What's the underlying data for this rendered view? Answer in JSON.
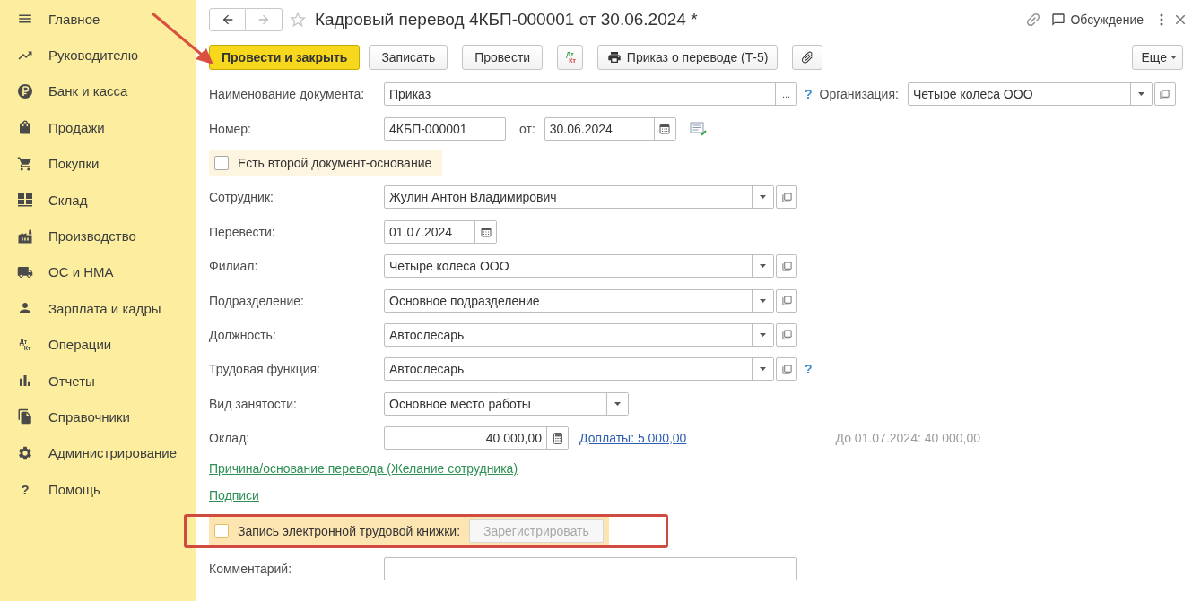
{
  "sidebar": {
    "items": [
      {
        "label": "Главное"
      },
      {
        "label": "Руководителю"
      },
      {
        "label": "Банк и касса"
      },
      {
        "label": "Продажи"
      },
      {
        "label": "Покупки"
      },
      {
        "label": "Склад"
      },
      {
        "label": "Производство"
      },
      {
        "label": "ОС и НМА"
      },
      {
        "label": "Зарплата и кадры"
      },
      {
        "label": "Операции",
        "icon_text": [
          "Дт",
          "Кт"
        ]
      },
      {
        "label": "Отчеты"
      },
      {
        "label": "Справочники"
      },
      {
        "label": "Администрирование"
      },
      {
        "label": "Помощь",
        "icon_text": [
          "?"
        ]
      }
    ]
  },
  "header": {
    "title": "Кадровый перевод 4КБП-000001 от 30.06.2024 *",
    "discussion": "Обсуждение"
  },
  "toolbar": {
    "buttons": [
      {
        "kind": "primary",
        "label": "Провести и закрыть"
      },
      {
        "kind": "plain",
        "label": "Записать"
      },
      {
        "kind": "plain",
        "label": "Провести"
      },
      {
        "kind": "dtkt",
        "texts": [
          "Дт",
          "Кт"
        ]
      },
      {
        "kind": "print",
        "label": "Приказ о переводе (Т-5)"
      },
      {
        "kind": "attach"
      }
    ],
    "more": "Еще"
  },
  "document_name": {
    "label": "Наименование документа:",
    "value": "Приказ",
    "choose": "...",
    "help": "?"
  },
  "organization": {
    "label": "Организация:",
    "value": "Четыре колеса ООО"
  },
  "number": {
    "label": "Номер:",
    "value": "4КБП-000001",
    "date_label": "от:",
    "date": "30.06.2024"
  },
  "second_basis": {
    "label": "Есть второй документ-основание",
    "checked": false
  },
  "fields": [
    {
      "kind": "select",
      "label": "Сотрудник:",
      "value": "Жулин Антон Владимирович"
    },
    {
      "kind": "date",
      "label": "Перевести:",
      "value": "01.07.2024"
    },
    {
      "kind": "select",
      "label": "Филиал:",
      "value": "Четыре колеса ООО"
    },
    {
      "kind": "select",
      "label": "Подразделение:",
      "value": "Основное подразделение"
    },
    {
      "kind": "select",
      "label": "Должность:",
      "value": "Автослесарь"
    },
    {
      "kind": "select",
      "label": "Трудовая функция:",
      "value": "Автослесарь",
      "help": "?"
    },
    {
      "kind": "dropdown",
      "label": "Вид занятости:",
      "value": "Основное место работы"
    },
    {
      "kind": "money",
      "label": "Оклад:",
      "value": "40 000,00",
      "link": "Доплаты: 5 000,00",
      "note": "До 01.07.2024: 40 000,00"
    }
  ],
  "links": [
    "Причина/основание перевода (Желание сотрудника)",
    "Подписи"
  ],
  "etk": {
    "label": "Запись электронной трудовой книжки:",
    "checked": false,
    "button": "Зарегистрировать",
    "disabled": true
  },
  "comment": {
    "label": "Комментарий:"
  }
}
